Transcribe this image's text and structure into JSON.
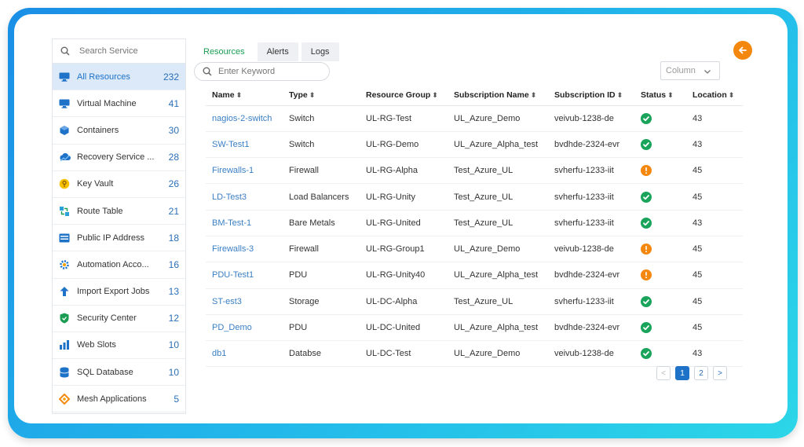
{
  "sidebar": {
    "search_placeholder": "Search Service",
    "items": [
      {
        "label": "All Resources",
        "count": "232",
        "icon": "monitor-icon",
        "active": true
      },
      {
        "label": "Virtual Machine",
        "count": "41",
        "icon": "monitor-icon"
      },
      {
        "label": "Containers",
        "count": "30",
        "icon": "containers-icon"
      },
      {
        "label": "Recovery Service ...",
        "count": "28",
        "icon": "cloud-icon"
      },
      {
        "label": "Key Vault",
        "count": "26",
        "icon": "key-icon"
      },
      {
        "label": "Route Table",
        "count": "21",
        "icon": "route-icon"
      },
      {
        "label": "Public IP Address",
        "count": "18",
        "icon": "ip-icon"
      },
      {
        "label": "Automation Acco...",
        "count": "16",
        "icon": "gear-icon"
      },
      {
        "label": "Import Export Jobs",
        "count": "13",
        "icon": "import-export-icon"
      },
      {
        "label": "Security Center",
        "count": "12",
        "icon": "shield-icon"
      },
      {
        "label": "Web Slots",
        "count": "10",
        "icon": "web-slots-icon"
      },
      {
        "label": "SQL Database",
        "count": "10",
        "icon": "database-icon"
      },
      {
        "label": "Mesh Applications",
        "count": "5",
        "icon": "mesh-icon"
      }
    ]
  },
  "tabs": [
    {
      "label": "Resources",
      "active": true
    },
    {
      "label": "Alerts"
    },
    {
      "label": "Logs"
    }
  ],
  "toolbar": {
    "keyword_placeholder": "Enter Keyword",
    "column_select": "Column"
  },
  "table": {
    "headers": [
      "Name",
      "Type",
      "Resource Group",
      "Subscription Name",
      "Subscription ID",
      "Status",
      "Location"
    ],
    "rows": [
      {
        "name": "nagios-2-switch",
        "type": "Switch",
        "group": "UL-RG-Test",
        "sub_name": "UL_Azure_Demo",
        "sub_id": "veivub-1238-de",
        "status": "ok",
        "location": "43"
      },
      {
        "name": "SW-Test1",
        "type": "Switch",
        "group": "UL-RG-Demo",
        "sub_name": "UL_Azure_Alpha_test",
        "sub_id": "bvdhde-2324-evr",
        "status": "ok",
        "location": "43"
      },
      {
        "name": "Firewalls-1",
        "type": "Firewall",
        "group": "UL-RG-Alpha",
        "sub_name": "Test_Azure_UL",
        "sub_id": "svherfu-1233-iit",
        "status": "warn",
        "location": "45"
      },
      {
        "name": "LD-Test3",
        "type": "Load Balancers",
        "group": "UL-RG-Unity",
        "sub_name": "Test_Azure_UL",
        "sub_id": "svherfu-1233-iit",
        "status": "ok",
        "location": "45"
      },
      {
        "name": "BM-Test-1",
        "type": "Bare Metals",
        "group": "UL-RG-United",
        "sub_name": "Test_Azure_UL",
        "sub_id": "svherfu-1233-iit",
        "status": "ok",
        "location": "43"
      },
      {
        "name": "Firewalls-3",
        "type": "Firewall",
        "group": "UL-RG-Group1",
        "sub_name": "UL_Azure_Demo",
        "sub_id": "veivub-1238-de",
        "status": "warn",
        "location": "45"
      },
      {
        "name": "PDU-Test1",
        "type": "PDU",
        "group": "UL-RG-Unity40",
        "sub_name": "UL_Azure_Alpha_test",
        "sub_id": "bvdhde-2324-evr",
        "status": "warn",
        "location": "45"
      },
      {
        "name": "ST-est3",
        "type": "Storage",
        "group": "UL-DC-Alpha",
        "sub_name": "Test_Azure_UL",
        "sub_id": "svherfu-1233-iit",
        "status": "ok",
        "location": "45"
      },
      {
        "name": "PD_Demo",
        "type": "PDU",
        "group": "UL-DC-United",
        "sub_name": "UL_Azure_Alpha_test",
        "sub_id": "bvdhde-2324-evr",
        "status": "ok",
        "location": "45"
      },
      {
        "name": "db1",
        "type": "Databse",
        "group": "UL-DC-Test",
        "sub_name": "UL_Azure_Demo",
        "sub_id": "veivub-1238-de",
        "status": "ok",
        "location": "43"
      }
    ]
  },
  "pagination": {
    "prev": "<",
    "pages": [
      "1",
      "2"
    ],
    "current": "1",
    "next": ">"
  },
  "colors": {
    "accent": "#1e72c8",
    "ok": "#1aa35a",
    "warn": "#f4880e",
    "link": "#3a7fc4"
  }
}
